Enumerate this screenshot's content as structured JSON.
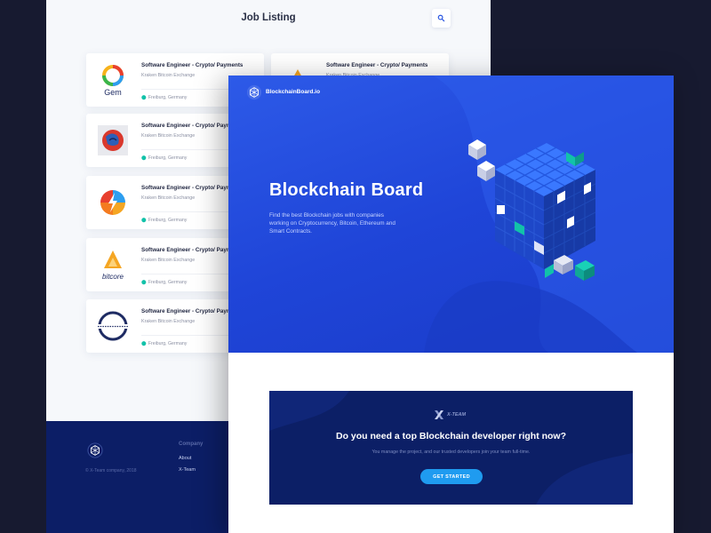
{
  "listing": {
    "title": "Job Listing",
    "search_icon": "search-icon",
    "jobs": [
      {
        "title": "Software Engineer - Crypto/ Payments",
        "company": "Kraken Bitcoin Exchange",
        "location": "Freiburg, Germany",
        "logo": "gem-logo",
        "logo_text": "Gem"
      },
      {
        "title": "Software Engineer - Crypto/ Payments",
        "company": "Kraken Bitcoin Exchange",
        "location": "",
        "logo": "bitcore-triangle-logo"
      },
      {
        "title": "Software Engineer - Crypto/ Payments",
        "company": "Kraken Bitcoin Exchange",
        "location": "Freiburg, Germany",
        "logo": "map-globe-logo"
      },
      {
        "title": "Software Engineer - Crypto/ Paym",
        "company": "Kraken Bitcoin Exchange",
        "location": "Freiburg, Germany",
        "logo": "lightning-circle-logo"
      },
      {
        "title": "Software Engineer - Crypto/ Paym",
        "company": "Kraken Bitcoin Exchange",
        "location": "Freiburg, Germany",
        "logo": "bitcore-logo",
        "logo_text": "bitcore"
      },
      {
        "title": "Software Engineer - Crypto/ Paym",
        "company": "Kraken Bitcoin Exchange",
        "location": "Freiburg, Germany",
        "logo": "ring-logo"
      }
    ],
    "footer": {
      "copyright": "© X-Team company, 2018",
      "company_heading": "Company",
      "links": [
        "About",
        "X-Team"
      ]
    }
  },
  "board": {
    "brand": "BlockchainBoard.io",
    "hero_title": "Blockchain Board",
    "hero_description": "Find the best Blockchain jobs with companies working on Cryptocurrency, Bitcoin, Ethereum and Smart Contracts.",
    "cta": {
      "brand": "X-TEAM",
      "title": "Do you need a top Blockchain developer right now?",
      "subtitle": "You manage the project, and our trusted developers join your team full-time.",
      "button": "GET STARTED"
    }
  },
  "colors": {
    "hero_blue": "#2552e0",
    "navy": "#0c1f66",
    "accent_teal": "#12c2a9",
    "button_blue": "#1f9bf0"
  }
}
